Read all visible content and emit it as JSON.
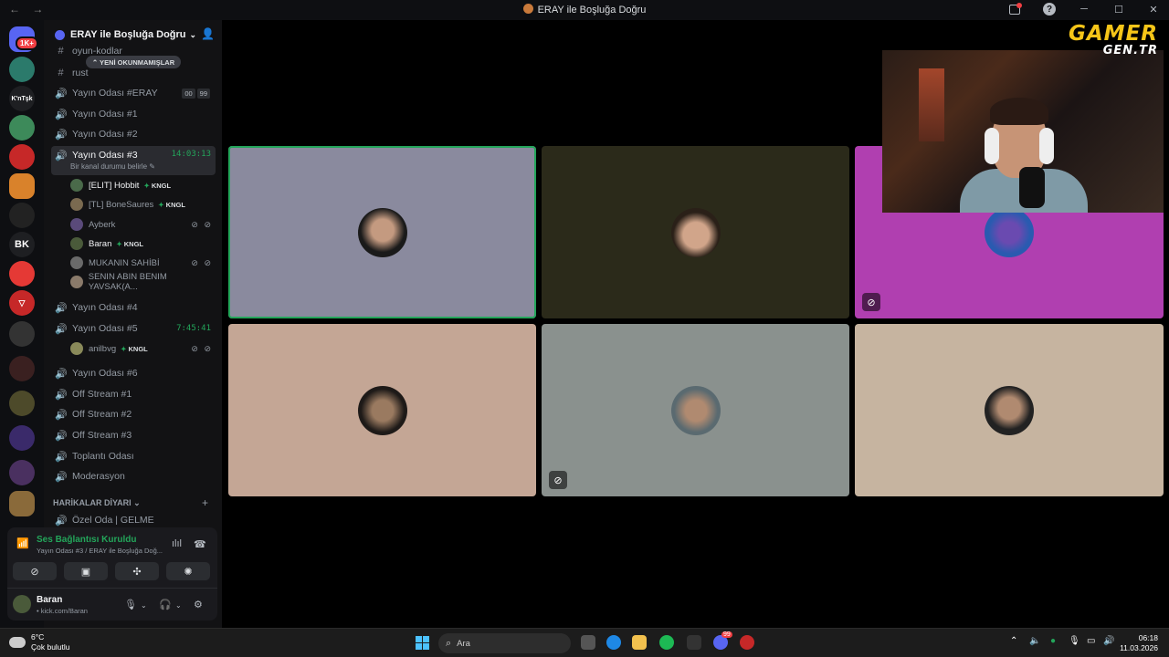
{
  "window": {
    "title": "ERAY ile Boşluğa Doğru",
    "back": "←",
    "forward": "→",
    "help": "?",
    "minimize": "─",
    "maximize": "☐",
    "close": "✕"
  },
  "server_list": {
    "badge": "1K+"
  },
  "guild": {
    "name": "ERAY ile Boşluğa Doğru",
    "chevron": "⌄",
    "invite_icon": "person-add-icon"
  },
  "unread_pill": "⌃ YENİ OKUNMAMIŞLAR",
  "channels": [
    {
      "type": "text",
      "icon": "#",
      "name": "oyun-kodlar"
    },
    {
      "type": "text",
      "icon": "#",
      "name": "rust"
    },
    {
      "type": "voice",
      "icon": "🔊",
      "name": "Yayın Odası #ERAY",
      "badges": [
        "00",
        "99"
      ]
    },
    {
      "type": "voice",
      "icon": "🔊",
      "name": "Yayın Odası #1"
    },
    {
      "type": "voice",
      "icon": "🔊",
      "name": "Yayın Odası #2"
    },
    {
      "type": "voice",
      "icon": "🔊",
      "name": "Yayın Odası #3",
      "timer": "14:03:13",
      "active": true,
      "status_hint": "Bir kanal durumu belirle ✎"
    },
    {
      "type": "voice",
      "icon": "🔊",
      "name": "Yayın Odası #4"
    },
    {
      "type": "voice",
      "icon": "🔊",
      "name": "Yayın Odası #5",
      "timer": "7:45:41"
    },
    {
      "type": "voice",
      "icon": "🔊",
      "name": "Yayın Odası #6"
    },
    {
      "type": "voice",
      "icon": "🔊",
      "name": "Off Stream #1"
    },
    {
      "type": "voice",
      "icon": "🔊",
      "name": "Off Stream #2"
    },
    {
      "type": "voice",
      "icon": "🔊",
      "name": "Off Stream #3"
    },
    {
      "type": "voice",
      "icon": "🔊",
      "name": "Toplantı Odası"
    },
    {
      "type": "voice",
      "icon": "🔊",
      "name": "Moderasyon"
    }
  ],
  "room3_users": [
    {
      "name": "[ELIT] Hobbit",
      "tag": "KNGL",
      "live": true
    },
    {
      "name": "[TL] BoneSaures",
      "tag": "KNGL",
      "live": false
    },
    {
      "name": "Ayberk",
      "tag": "",
      "live": false,
      "muted": "⊘ ⊘"
    },
    {
      "name": "Baran",
      "tag": "KNGL",
      "live": true
    },
    {
      "name": "MUKANIN SAHİBİ",
      "tag": "",
      "live": false,
      "muted": "⊘ ⊘"
    },
    {
      "name": "SENIN ABIN BENIM YAVSAK(A...",
      "tag": "",
      "live": false
    }
  ],
  "room5_users": [
    {
      "name": "anilbvg",
      "tag": "KNGL",
      "muted": "⊘ ⊘"
    }
  ],
  "category": {
    "name": "HARİKALAR DİYARI ⌄",
    "plus": "+"
  },
  "extra_channel": {
    "icon": "🔊",
    "name": "Özel Oda | GELME"
  },
  "voice_panel": {
    "status": "Ses Bağlantısı Kuruldu",
    "location": "Yayın Odası #3 / ERAY ile Boşluğa Doğ...",
    "user_name": "Baran",
    "user_link": "• kick.com/Baran"
  },
  "colors": {
    "tile_1": "#8a8a9e",
    "tile_2": "#2b2a1a",
    "tile_3": "#b03fb0",
    "tile_4": "#c4a695",
    "tile_5": "#8a918e",
    "tile_6": "#c6b4a0",
    "speaking": "#23a55a"
  },
  "overlay_logo": {
    "line1": "GAMER",
    "line2": "GEN.TR"
  },
  "taskbar": {
    "temperature": "6°C",
    "weather": "Çok bulutlu",
    "search_placeholder": "Ara",
    "time": "06:18",
    "date": "11.03.2026",
    "discord_badge": "99"
  }
}
